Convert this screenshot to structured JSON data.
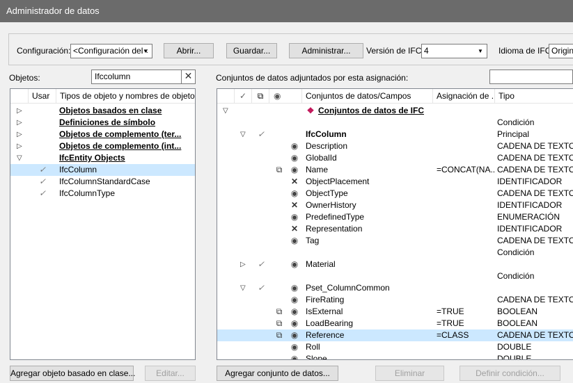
{
  "window": {
    "title": "Administrador de datos"
  },
  "toolbar": {
    "config_label": "Configuración:",
    "config_value": "<Configuración del ‹",
    "open": "Abrir...",
    "save": "Guardar...",
    "manage": "Administrar...",
    "ifc_version_label": "Versión de IFC:",
    "ifc_version_value": "4",
    "ifc_lang_label": "Idioma de IFC:",
    "ifc_lang_value": "Origina"
  },
  "objects": {
    "label": "Objetos:",
    "search_value": "Ifccolumn",
    "headers": [
      "Usar",
      "Tipos de objeto y nombres de objeto"
    ],
    "rows": [
      {
        "text": "Objetos basados en clase",
        "style": "bu",
        "tri": "▷",
        "check": ""
      },
      {
        "text": "Definiciones de símbolo",
        "style": "bu",
        "tri": "▷",
        "check": ""
      },
      {
        "text": "Objetos de complemento (ter...",
        "style": "bu",
        "tri": "▷",
        "check": ""
      },
      {
        "text": "Objetos de complemento (int...",
        "style": "bu",
        "tri": "▷",
        "check": ""
      },
      {
        "text": "IfcEntity Objects",
        "style": "bu",
        "tri": "▽",
        "check": ""
      },
      {
        "text": "IfcColumn",
        "style": "",
        "tri": "",
        "check": "✓"
      },
      {
        "text": "IfcColumnStandardCase",
        "style": "",
        "tri": "",
        "check": "✓"
      },
      {
        "text": "IfcColumnType",
        "style": "",
        "tri": "",
        "check": "✓"
      }
    ]
  },
  "datasets": {
    "label": "Conjuntos de datos adjuntados por esta asignación:",
    "search_value": "",
    "headers": [
      "Conjuntos de datos/Campos",
      "Asignación de ...",
      "Tipo"
    ],
    "rows": [
      {
        "name": "Conjuntos de datos de IFC",
        "style": "bu",
        "tri": "▽",
        "tri_col": 0,
        "check": "",
        "map": "",
        "eye": "",
        "field_icon": "datasets",
        "assign": "",
        "type": ""
      },
      {
        "name": "",
        "style": "",
        "tri": "",
        "tri_col": 0,
        "check": "",
        "map": "",
        "eye": "",
        "field_icon": "",
        "assign": "",
        "type": "Condición"
      },
      {
        "name": "IfcColumn",
        "style": "b",
        "tri": "▽",
        "tri_col": 1,
        "check": "✓",
        "map": "",
        "eye": "",
        "field_icon": "",
        "assign": "",
        "type": "Principal"
      },
      {
        "name": "Description",
        "style": "",
        "tri": "",
        "tri_col": 0,
        "check": "",
        "map": "",
        "eye": "◉",
        "field_icon": "",
        "assign": "",
        "type": "CADENA DE TEXTO"
      },
      {
        "name": "GlobalId",
        "style": "",
        "tri": "",
        "tri_col": 0,
        "check": "",
        "map": "",
        "eye": "◉",
        "field_icon": "",
        "assign": "",
        "type": "CADENA DE TEXTO"
      },
      {
        "name": "Name",
        "style": "",
        "tri": "",
        "tri_col": 0,
        "check": "",
        "map": "⧉",
        "eye": "◉",
        "field_icon": "",
        "assign": "=CONCAT(NA...",
        "type": "CADENA DE TEXTO"
      },
      {
        "name": "ObjectPlacement",
        "style": "",
        "tri": "",
        "tri_col": 0,
        "check": "",
        "map": "",
        "eye": "✕",
        "field_icon": "",
        "assign": "",
        "type": "IDENTIFICADOR"
      },
      {
        "name": "ObjectType",
        "style": "",
        "tri": "",
        "tri_col": 0,
        "check": "",
        "map": "",
        "eye": "◉",
        "field_icon": "",
        "assign": "",
        "type": "CADENA DE TEXTO"
      },
      {
        "name": "OwnerHistory",
        "style": "",
        "tri": "",
        "tri_col": 0,
        "check": "",
        "map": "",
        "eye": "✕",
        "field_icon": "",
        "assign": "",
        "type": "IDENTIFICADOR"
      },
      {
        "name": "PredefinedType",
        "style": "",
        "tri": "",
        "tri_col": 0,
        "check": "",
        "map": "",
        "eye": "◉",
        "field_icon": "",
        "assign": "",
        "type": "ENUMERACIÓN"
      },
      {
        "name": "Representation",
        "style": "",
        "tri": "",
        "tri_col": 0,
        "check": "",
        "map": "",
        "eye": "✕",
        "field_icon": "",
        "assign": "",
        "type": "IDENTIFICADOR"
      },
      {
        "name": "Tag",
        "style": "",
        "tri": "",
        "tri_col": 0,
        "check": "",
        "map": "",
        "eye": "◉",
        "field_icon": "",
        "assign": "",
        "type": "CADENA DE TEXTO"
      },
      {
        "name": "",
        "style": "",
        "tri": "",
        "tri_col": 0,
        "check": "",
        "map": "",
        "eye": "",
        "field_icon": "",
        "assign": "",
        "type": "Condición"
      },
      {
        "name": "Material",
        "style": "",
        "tri": "▷",
        "tri_col": 1,
        "check": "✓",
        "map": "",
        "eye": "◉",
        "field_icon": "",
        "assign": "",
        "type": ""
      },
      {
        "name": "",
        "style": "",
        "tri": "",
        "tri_col": 0,
        "check": "",
        "map": "",
        "eye": "",
        "field_icon": "",
        "assign": "",
        "type": "Condición"
      },
      {
        "name": "Pset_ColumnCommon",
        "style": "",
        "tri": "▽",
        "tri_col": 1,
        "check": "✓",
        "map": "",
        "eye": "◉",
        "field_icon": "",
        "assign": "",
        "type": ""
      },
      {
        "name": "FireRating",
        "style": "",
        "tri": "",
        "tri_col": 0,
        "check": "",
        "map": "",
        "eye": "◉",
        "field_icon": "",
        "assign": "",
        "type": "CADENA DE TEXTO"
      },
      {
        "name": "IsExternal",
        "style": "",
        "tri": "",
        "tri_col": 0,
        "check": "",
        "map": "⧉",
        "eye": "◉",
        "field_icon": "",
        "assign": "=TRUE",
        "type": "BOOLEAN"
      },
      {
        "name": "LoadBearing",
        "style": "",
        "tri": "",
        "tri_col": 0,
        "check": "",
        "map": "⧉",
        "eye": "◉",
        "field_icon": "",
        "assign": "=TRUE",
        "type": "BOOLEAN"
      },
      {
        "name": "Reference",
        "style": "",
        "tri": "",
        "tri_col": 0,
        "check": "",
        "map": "⧉",
        "eye": "◉",
        "field_icon": "",
        "assign": "=CLASS",
        "type": "CADENA DE TEXTO"
      },
      {
        "name": "Roll",
        "style": "",
        "tri": "",
        "tri_col": 0,
        "check": "",
        "map": "",
        "eye": "◉",
        "field_icon": "",
        "assign": "",
        "type": "DOUBLE"
      },
      {
        "name": "Slope",
        "style": "",
        "tri": "",
        "tri_col": 0,
        "check": "",
        "map": "",
        "eye": "◉",
        "field_icon": "",
        "assign": "",
        "type": "DOUBLE"
      }
    ],
    "selected_index": 19
  },
  "buttons": {
    "add_object": "Agregar objeto basado en clase...",
    "edit": "Editar...",
    "add_dataset": "Agregar conjunto de datos...",
    "delete": "Eliminar",
    "define_condition": "Definir condición..."
  },
  "colors": {
    "selection": "#cce8ff",
    "titlebar": "#6b6b6b"
  }
}
